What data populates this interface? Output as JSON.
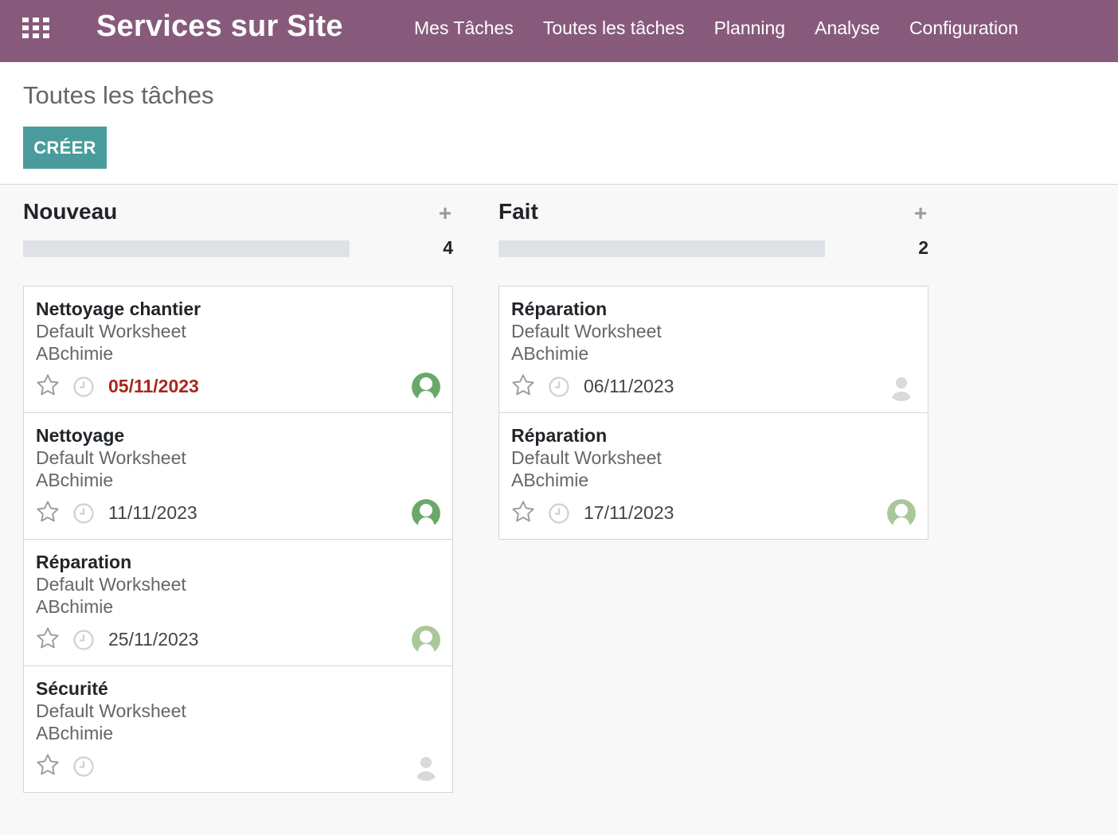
{
  "navbar": {
    "app_name": "Services sur Site",
    "menu": [
      "Mes Tâches",
      "Toutes les tâches",
      "Planning",
      "Analyse",
      "Configuration"
    ]
  },
  "control_panel": {
    "breadcrumb": "Toutes les tâches",
    "create_label": "CRÉER"
  },
  "columns": [
    {
      "title": "Nouveau",
      "count": "4",
      "cards": [
        {
          "title": "Nettoyage chantier",
          "worksheet": "Default Worksheet",
          "customer": "ABchimie",
          "date": "05/11/2023",
          "overdue": true,
          "avatar": "green-dark"
        },
        {
          "title": "Nettoyage",
          "worksheet": "Default Worksheet",
          "customer": "ABchimie",
          "date": "11/11/2023",
          "overdue": false,
          "avatar": "green-dark"
        },
        {
          "title": "Réparation",
          "worksheet": "Default Worksheet",
          "customer": "ABchimie",
          "date": "25/11/2023",
          "overdue": false,
          "avatar": "green-light"
        },
        {
          "title": "Sécurité",
          "worksheet": "Default Worksheet",
          "customer": "ABchimie",
          "date": "",
          "overdue": false,
          "avatar": "unassigned"
        }
      ]
    },
    {
      "title": "Fait",
      "count": "2",
      "cards": [
        {
          "title": "Réparation",
          "worksheet": "Default Worksheet",
          "customer": "ABchimie",
          "date": "06/11/2023",
          "overdue": false,
          "avatar": "unassigned"
        },
        {
          "title": "Réparation",
          "worksheet": "Default Worksheet",
          "customer": "ABchimie",
          "date": "17/11/2023",
          "overdue": false,
          "avatar": "green-light"
        }
      ]
    }
  ],
  "colors": {
    "navbar": "#875a7b",
    "create_button": "#4a9c9c",
    "overdue_date": "#a8271b",
    "avatar_green_dark": "#6aa86a",
    "avatar_green_light": "#a9c79a",
    "avatar_unassigned": "#d9d9d9"
  },
  "icons": [
    "apps-grid-icon",
    "add-icon",
    "star-icon",
    "clock-icon",
    "user-avatar-icon"
  ]
}
